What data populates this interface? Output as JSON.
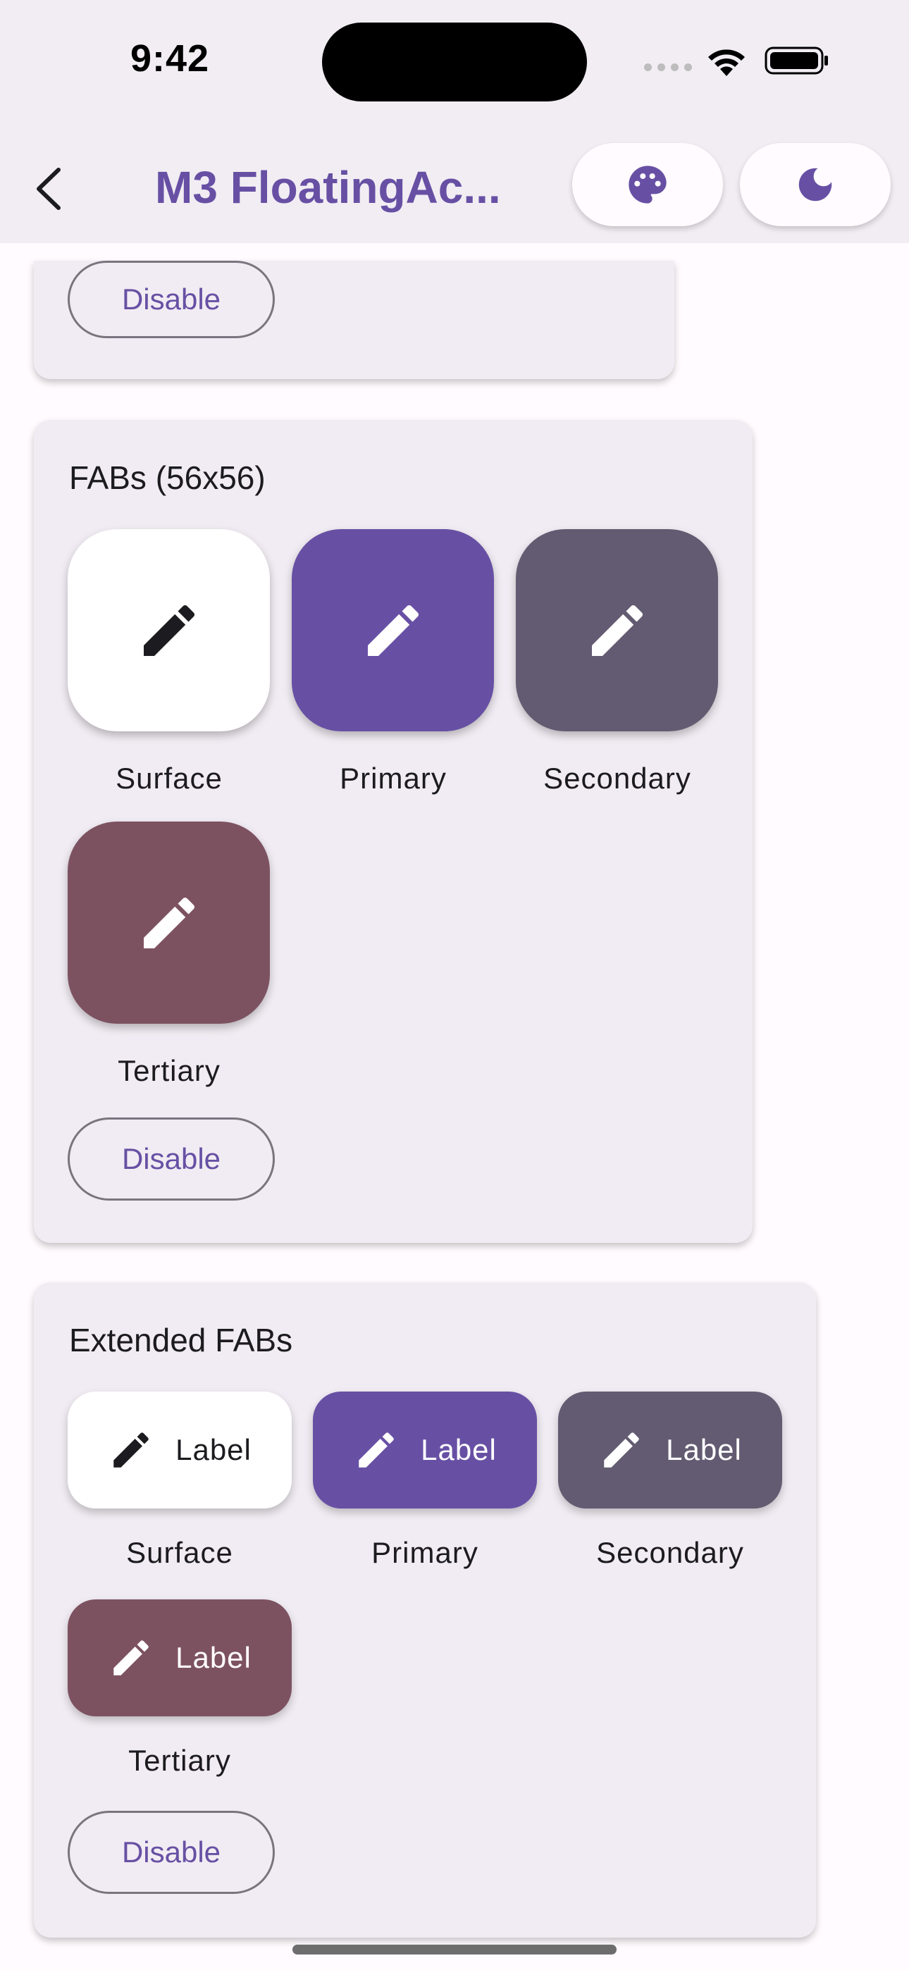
{
  "status_bar": {
    "time": "9:42"
  },
  "app_bar": {
    "title": "M3 FloatingAc...",
    "back_icon": "back-arrow-icon",
    "theme_icon": "palette-icon",
    "mode_icon": "moon-icon",
    "accent": "#6750A4"
  },
  "previous_card": {
    "disable_label": "Disable"
  },
  "fab_card": {
    "title": "FABs (56x56)",
    "items": [
      {
        "label": "Surface",
        "bg": "#FFFFFF",
        "fg": "#1C1B1F",
        "icon": "pencil-icon"
      },
      {
        "label": "Primary",
        "bg": "#6750A4",
        "fg": "#FFFFFF",
        "icon": "pencil-icon"
      },
      {
        "label": "Secondary",
        "bg": "#625B71",
        "fg": "#FFFFFF",
        "icon": "pencil-icon"
      },
      {
        "label": "Tertiary",
        "bg": "#7D5260",
        "fg": "#FFFFFF",
        "icon": "pencil-icon"
      }
    ],
    "disable_label": "Disable"
  },
  "extended_card": {
    "title": "Extended FABs",
    "button_text": "Label",
    "items": [
      {
        "label": "Surface",
        "bg": "#FFFFFF",
        "fg": "#1C1B1F"
      },
      {
        "label": "Primary",
        "bg": "#6750A4",
        "fg": "#FFFFFF"
      },
      {
        "label": "Secondary",
        "bg": "#625B71",
        "fg": "#FFFFFF"
      },
      {
        "label": "Tertiary",
        "bg": "#7D5260",
        "fg": "#FFFFFF"
      }
    ],
    "disable_label": "Disable"
  }
}
